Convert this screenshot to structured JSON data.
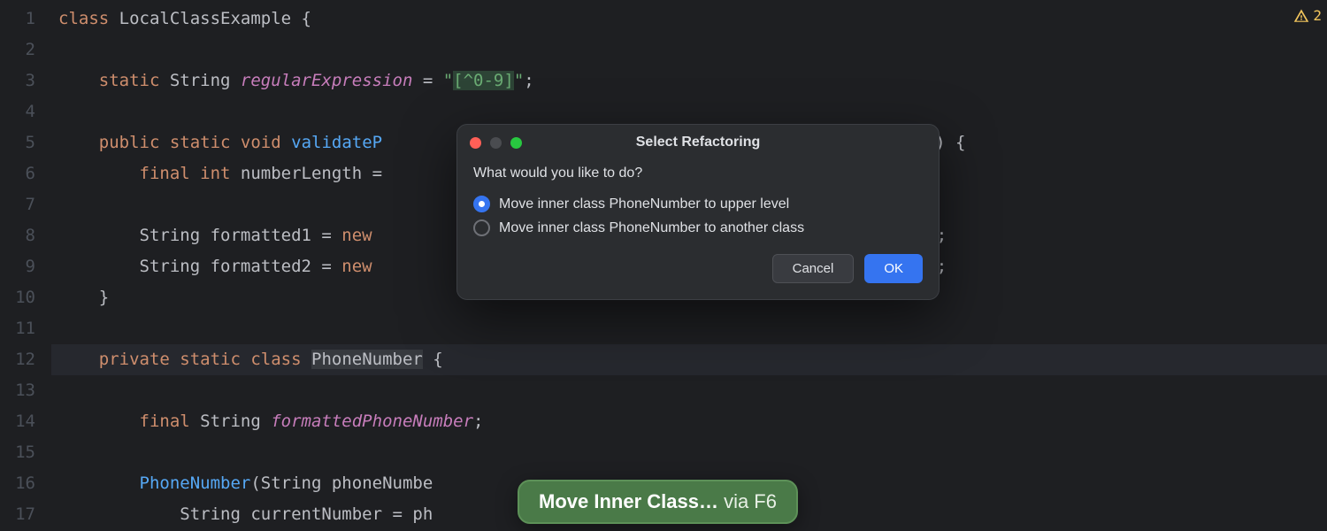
{
  "editor": {
    "lines": [
      1,
      2,
      3,
      4,
      5,
      6,
      7,
      8,
      9,
      10,
      11,
      12,
      13,
      14,
      15,
      16,
      17
    ],
    "gutter_icon_line": 16,
    "code": {
      "l1": {
        "p1": "class",
        "p2": " LocalClassExample ",
        "p3": "{"
      },
      "l3": {
        "indent": "    ",
        "p1": "static",
        "p2": " String ",
        "p3": "regularExpression",
        "p4": " = ",
        "p5": "\"",
        "p6": "[^0-9]",
        "p7": "\"",
        "p8": ";"
      },
      "l5": {
        "indent": "    ",
        "p1": "public static void",
        "p2": " ",
        "p3": "validateP",
        "p4": "Number2) {"
      },
      "l6": {
        "indent": "        ",
        "p1": "final int",
        "p2": " numberLength ="
      },
      "l8": {
        "indent": "        ",
        "p1": "String formatted1 = ",
        "p2": "new",
        "p3": "umber();"
      },
      "l9": {
        "indent": "        ",
        "p1": "String formatted2 = ",
        "p2": "new",
        "p3": "umber();"
      },
      "l10": {
        "indent": "    ",
        "p1": "}"
      },
      "l12": {
        "indent": "    ",
        "p1": "private static class",
        "p2": " ",
        "p3": "PhoneNumber",
        "p4": " {"
      },
      "l14": {
        "indent": "        ",
        "p1": "final",
        "p2": " String ",
        "p3": "formattedPhoneNumber",
        "p4": ";"
      },
      "l16": {
        "indent": "        ",
        "p1": "PhoneNumber",
        "p2": "(String phoneNumbe"
      },
      "l17": {
        "indent": "            ",
        "p1": "String currentNumber = ph"
      }
    }
  },
  "warning": {
    "count": "2"
  },
  "dialog": {
    "title": "Select Refactoring",
    "prompt": "What would you like to do?",
    "options": [
      {
        "label": "Move inner class PhoneNumber to upper level",
        "checked": true
      },
      {
        "label": "Move inner class PhoneNumber to another class",
        "checked": false
      }
    ],
    "buttons": {
      "cancel": "Cancel",
      "ok": "OK"
    }
  },
  "hint": {
    "strong": "Move Inner Class…",
    "rest": " via F6"
  }
}
